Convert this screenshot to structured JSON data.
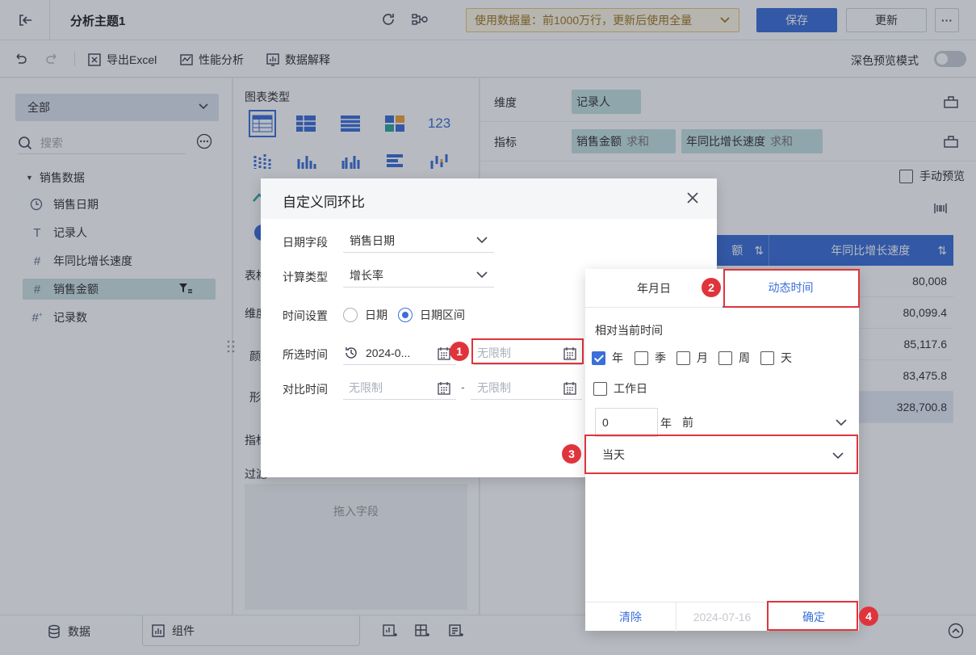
{
  "topbar": {
    "title": "分析主题1",
    "usage_text": "使用数据量：前1000万行，更新后使用全量",
    "save_label": "保存",
    "update_label": "更新",
    "more_label": "···"
  },
  "toolbar": {
    "export_label": "导出Excel",
    "perf_label": "性能分析",
    "explain_label": "数据解释",
    "dark_preview_label": "深色预览模式"
  },
  "left": {
    "scope": "全部",
    "search_placeholder": "搜索",
    "root": "销售数据",
    "fields": [
      {
        "icon": "clock",
        "label": "销售日期"
      },
      {
        "icon": "text",
        "label": "记录人"
      },
      {
        "icon": "number",
        "label": "年同比增长速度"
      },
      {
        "icon": "number",
        "label": "销售金额"
      },
      {
        "icon": "number-plus",
        "label": "记录数"
      }
    ]
  },
  "mid": {
    "chart_type_label": "图表类型",
    "chart_icon_number": "123",
    "section_table": "表格",
    "section_dim": "维度",
    "row3_char": "颜",
    "row4_char": "形",
    "section_metric": "指标",
    "section_filter": "过滤",
    "drop_hint": "拖入字段"
  },
  "right": {
    "dim_label": "维度",
    "dim_pill": "记录人",
    "metric_label": "指标",
    "metric_pill1": "销售金额",
    "metric_pill1_sub": "求和",
    "metric_pill2": "年同比增长速度",
    "metric_pill2_sub": "求和",
    "manual_preview": "手动预览",
    "col1_header": "额",
    "col2_header": "年同比增长速度",
    "values": [
      "80,008",
      "80,099.4",
      "85,117.6",
      "83,475.8",
      "328,700.8"
    ]
  },
  "bottom": {
    "data_tab": "数据",
    "component_tab": "组件"
  },
  "dialog": {
    "title": "自定义同环比",
    "date_field_label": "日期字段",
    "date_field_value": "销售日期",
    "calc_type_label": "计算类型",
    "calc_type_value": "增长率",
    "time_setting_label": "时间设置",
    "radio_date": "日期",
    "radio_range": "日期区间",
    "selected_time_label": "所选时间",
    "selected_start": "2024-0...",
    "selected_end_placeholder": "无限制",
    "compare_time_label": "对比时间",
    "compare_start_placeholder": "无限制",
    "compare_dash": "-",
    "compare_end_placeholder": "无限制"
  },
  "popup": {
    "tab_ymd": "年月日",
    "tab_dynamic": "动态时间",
    "relative_label": "相对当前时间",
    "checks": [
      {
        "label": "年",
        "checked": true
      },
      {
        "label": "季",
        "checked": false
      },
      {
        "label": "月",
        "checked": false
      },
      {
        "label": "周",
        "checked": false
      },
      {
        "label": "天",
        "checked": false
      }
    ],
    "workday_label": "工作日",
    "offset_value": "0",
    "offset_unit": "年",
    "offset_dir": "前",
    "anchor_value": "当天",
    "clear_label": "清除",
    "date_preview": "2024-07-16",
    "confirm_label": "确定"
  },
  "badges": [
    "1",
    "2",
    "3",
    "4"
  ],
  "colors": {
    "primary": "#3b6fd9",
    "highlight": "#e0343c",
    "pill": "#c6e2e4"
  }
}
